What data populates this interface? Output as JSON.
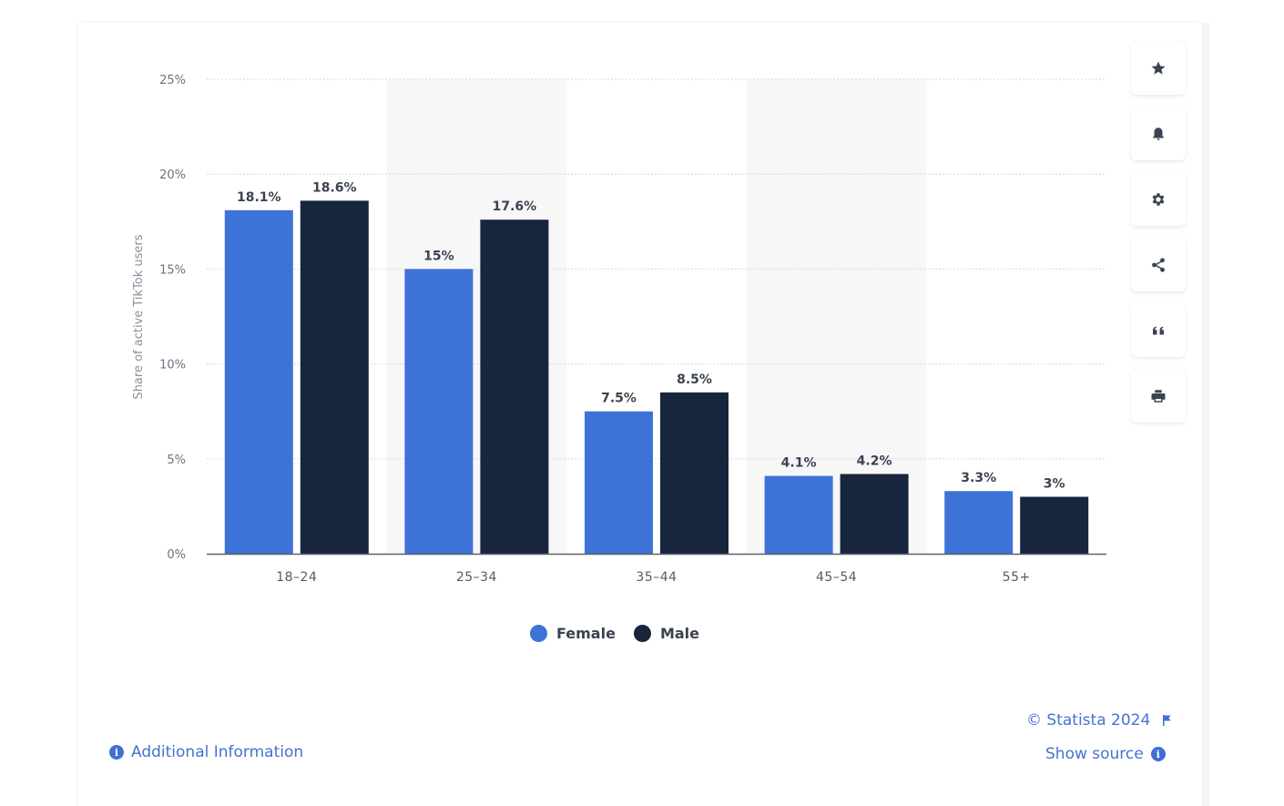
{
  "chart_data": {
    "type": "bar",
    "title": "",
    "xlabel": "",
    "ylabel": "Share of active TikTok users",
    "ylim": [
      0,
      25
    ],
    "yticks": [
      0,
      5,
      10,
      15,
      20,
      25
    ],
    "ytick_labels": [
      "0%",
      "5%",
      "10%",
      "15%",
      "20%",
      "25%"
    ],
    "grid": true,
    "categories": [
      "18-24",
      "25-34",
      "35-44",
      "45-54",
      "55+"
    ],
    "series": [
      {
        "name": "Female",
        "color": "#3d72d7",
        "values": [
          18.1,
          15,
          7.5,
          4.1,
          3.3
        ],
        "labels": [
          "18.1%",
          "15%",
          "7.5%",
          "4.1%",
          "3.3%"
        ]
      },
      {
        "name": "Male",
        "color": "#17263c",
        "values": [
          18.6,
          17.6,
          8.5,
          4.2,
          3
        ],
        "labels": [
          "18.6%",
          "17.6%",
          "8.5%",
          "4.2%",
          "3%"
        ]
      }
    ],
    "legend_position": "bottom-center"
  },
  "legend": {
    "items": [
      {
        "label": "Female",
        "color": "#3d72d7"
      },
      {
        "label": "Male",
        "color": "#17263c"
      }
    ]
  },
  "toolbar": {
    "buttons": [
      {
        "name": "favorite",
        "icon": "star-icon"
      },
      {
        "name": "notification",
        "icon": "bell-icon"
      },
      {
        "name": "settings",
        "icon": "gear-icon"
      },
      {
        "name": "share",
        "icon": "share-icon"
      },
      {
        "name": "cite",
        "icon": "quote-icon"
      },
      {
        "name": "print",
        "icon": "print-icon"
      }
    ]
  },
  "footer": {
    "copyright": "© Statista 2024",
    "show_source": "Show source",
    "additional_info": "Additional Information"
  },
  "colors": {
    "accent": "#4473d1",
    "band": "#f7f7f8"
  }
}
